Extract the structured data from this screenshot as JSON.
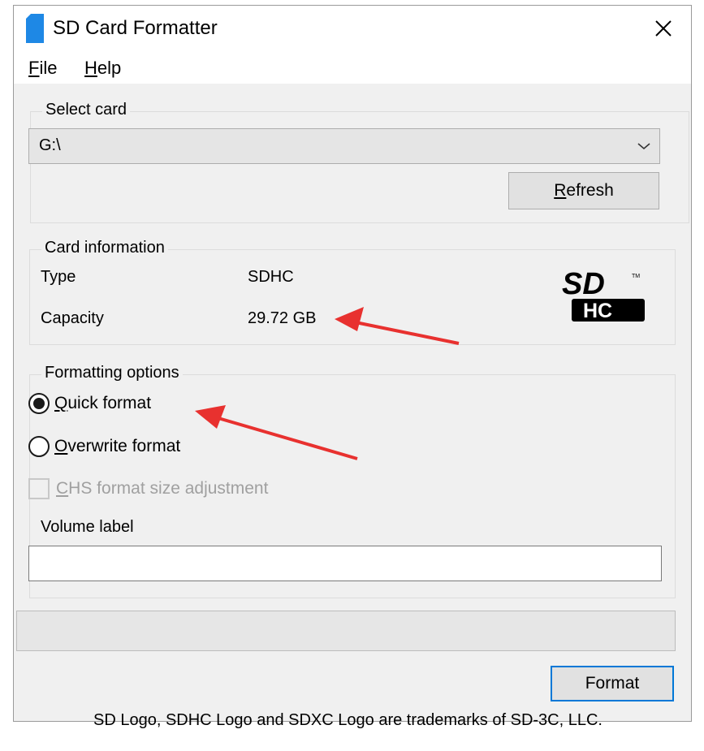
{
  "window": {
    "title": "SD Card Formatter",
    "icon": "sd-card-icon"
  },
  "menu": {
    "file": {
      "accel": "F",
      "rest": "ile"
    },
    "help": {
      "accel": "H",
      "rest": "elp"
    }
  },
  "select_card": {
    "legend": "Select card",
    "selected": "G:\\",
    "refresh_accel": "R",
    "refresh_rest": "efresh"
  },
  "card_info": {
    "legend": "Card information",
    "type_label": "Type",
    "type_value": "SDHC",
    "capacity_label": "Capacity",
    "capacity_value": "29.72 GB",
    "logo_top": "SD",
    "logo_bottom": "HC",
    "logo_tm": "TM"
  },
  "formatting": {
    "legend": "Formatting options",
    "quick_accel": "Q",
    "quick_rest": "uick format",
    "quick_selected": true,
    "overwrite_accel": "O",
    "overwrite_rest": "verwrite format",
    "chs_accel": "C",
    "chs_rest": "HS format size adjustment",
    "volume_label": "Volume label",
    "volume_value": ""
  },
  "progress": {
    "value": 0
  },
  "format_button": "Format",
  "footer": "SD Logo, SDHC Logo and SDXC Logo are trademarks of SD-3C, LLC.",
  "colors": {
    "annotation_arrow": "#e8312f",
    "default_button_border": "#0078d7",
    "app_icon": "#1e88e5"
  }
}
